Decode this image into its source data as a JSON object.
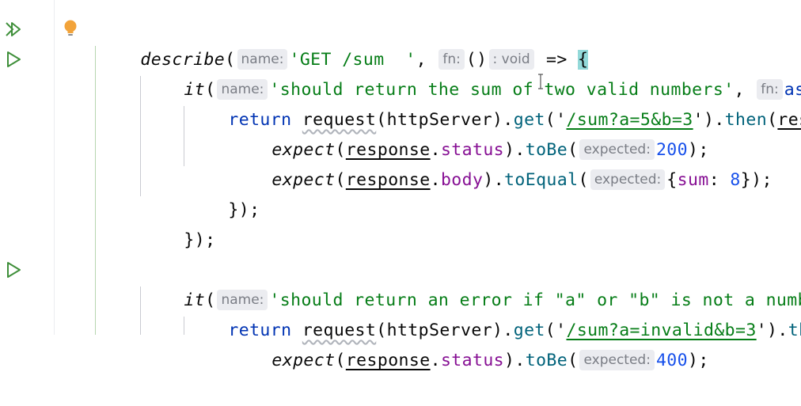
{
  "gutter": {
    "icons": [
      "run-all-tests-icon",
      "run-test-icon",
      "run-test-icon"
    ]
  },
  "code": {
    "l1": {
      "fn": "describe",
      "paren": "(",
      "hint_name": "name:",
      "str": "'GET /sum  '",
      "comma": ",",
      "hint_fn": "fn:",
      "parens": "()",
      "hint_void": ": void",
      "arrow": " => ",
      "brace": "{"
    },
    "l2": {
      "fn": "it",
      "paren": "(",
      "hint_name": "name:",
      "str": "'should return the sum of two valid numbers'",
      "comma": ", ",
      "hint_fn": "fn:",
      "tail": "asy"
    },
    "l3": {
      "kw": "return",
      "req": "request",
      "p1": "(httpServer).",
      "get": "get",
      "p2": "('",
      "url": "/sum?a=5&b=3",
      "p3": "').",
      "then": "then",
      "p4": "(",
      "tail": "respo"
    },
    "l4": {
      "fn": "expect",
      "p1": "(",
      "obj": "response",
      "dot": ".",
      "prop": "status",
      "p2": ").",
      "method": "toBe",
      "p3": "(",
      "hint": "expected:",
      "num": "200",
      "end": ");"
    },
    "l5": {
      "fn": "expect",
      "p1": "(",
      "obj": "response",
      "dot": ".",
      "prop": "body",
      "p2": ").",
      "method": "toEqual",
      "p3": "(",
      "hint": "expected:",
      "b1": "{",
      "key": "sum",
      "colon": ": ",
      "num": "8",
      "end": "});"
    },
    "l6": {
      "text": "});"
    },
    "l7": {
      "text": "});"
    },
    "l8": {
      "fn": "it",
      "paren": "(",
      "hint_name": "name:",
      "str": "'should return an error if \"a\" or \"b\" is not a numbe"
    },
    "l9": {
      "kw": "return",
      "req": "request",
      "p1": "(httpServer).",
      "get": "get",
      "p2": "('",
      "url": "/sum?a=invalid&b=3",
      "p3": "').",
      "tail": "ther"
    },
    "l10": {
      "fn": "expect",
      "p1": "(",
      "obj": "response",
      "dot": ".",
      "prop": "status",
      "p2": ").",
      "method": "toBe",
      "p3": "(",
      "hint": "expected:",
      "num": "400",
      "end": ");"
    }
  }
}
